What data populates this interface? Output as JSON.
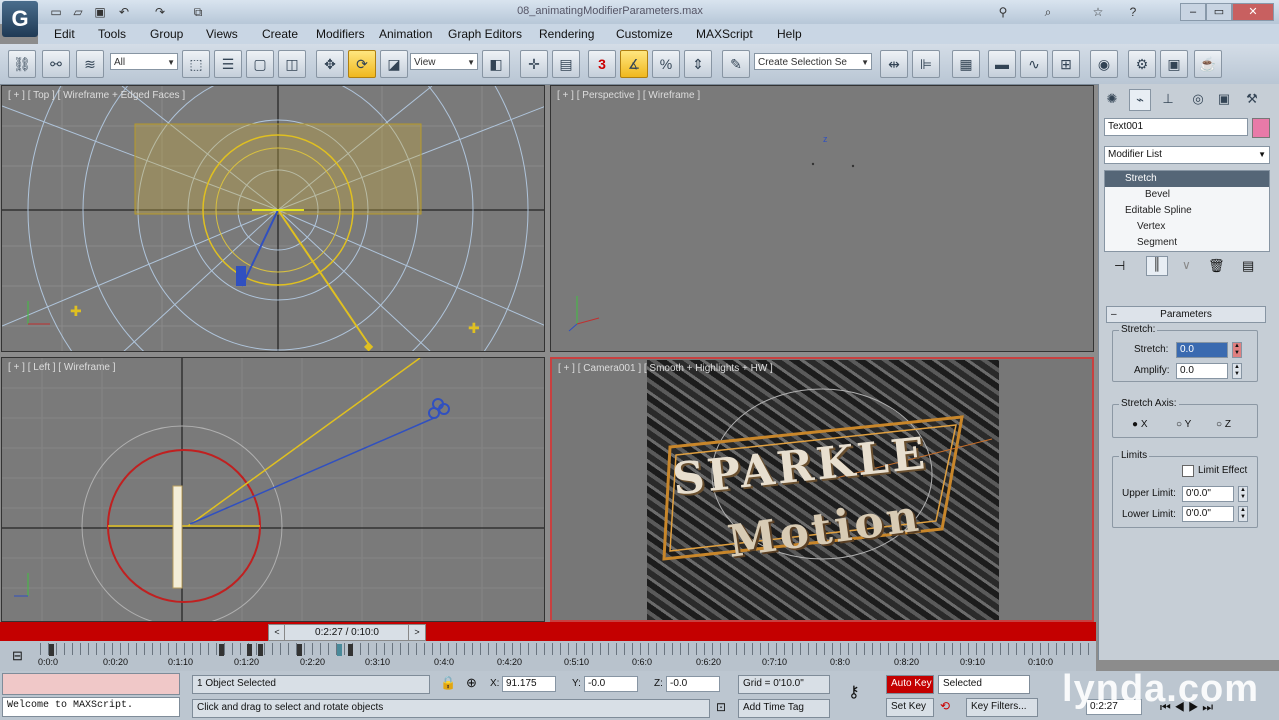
{
  "app": {
    "title": "08_animatingModifierParameters.max",
    "logo": "G"
  },
  "quick_access": [
    "new-icon",
    "open-icon",
    "save-icon",
    "undo-icon",
    "redo-icon",
    "project-icon"
  ],
  "menu": [
    "Edit",
    "Tools",
    "Group",
    "Views",
    "Create",
    "Modifiers",
    "Animation",
    "Graph Editors",
    "Rendering",
    "Customize",
    "MAXScript",
    "Help"
  ],
  "toolbar": {
    "selection_filter": "All",
    "reference_coord": "View",
    "named_selection": "Create Selection Se",
    "snap_label": "3"
  },
  "viewports": {
    "top": "[ + ] [ Top ] [ Wireframe + Edged Faces ]",
    "perspective": "[ + ] [ Perspective ] [ Wireframe ]",
    "left": "[ + ] [ Left ] [ Wireframe ]",
    "camera": "[ + ] [ Camera001 ] [ Smooth + Highlights + HW ]"
  },
  "render": {
    "line1": "SPARKLE",
    "line2": "Motion"
  },
  "command_panel": {
    "object_name": "Text001",
    "modifier_list": "Modifier List",
    "stack": [
      "Stretch",
      "Bevel",
      "Editable Spline",
      "Vertex",
      "Segment"
    ],
    "rollout_title": "Parameters",
    "stretch_group": "Stretch:",
    "stretch_label": "Stretch:",
    "stretch_value": "0.0",
    "amplify_label": "Amplify:",
    "amplify_value": "0.0",
    "axis_group": "Stretch Axis:",
    "axes": [
      "X",
      "Y",
      "Z"
    ],
    "selected_axis": "X",
    "limits_group": "Limits",
    "limit_effect": "Limit Effect",
    "upper_label": "Upper Limit:",
    "upper_value": "0'0.0\"",
    "lower_label": "Lower Limit:",
    "lower_value": "0'0.0\""
  },
  "timeline": {
    "slider_label": "0:2:27 / 0:10:0",
    "ticks": [
      "0:0:0",
      "0:0:20",
      "0:1:10",
      "0:1:20",
      "0:2:20",
      "0:3:10",
      "0:4:0",
      "0:4:20",
      "0:5:10",
      "0:6:0",
      "0:6:20",
      "0:7:10",
      "0:8:0",
      "0:8:20",
      "0:9:10",
      "0:10:0"
    ]
  },
  "status": {
    "maxscript": "Welcome to MAXScript.",
    "selection": "1 Object Selected",
    "prompt": "Click and drag to select and rotate objects",
    "x_label": "X:",
    "x_value": "91.175",
    "y_label": "Y:",
    "y_value": "-0.0",
    "z_label": "Z:",
    "z_value": "-0.0",
    "grid": "Grid = 0'10.0\"",
    "add_time_tag": "Add Time Tag",
    "auto_key": "Auto Key",
    "selected": "Selected",
    "set_key": "Set Key",
    "key_filters": "Key Filters...",
    "current_frame": "0:2:27"
  },
  "watermark": "lynda.com",
  "colors": {
    "auto_key": "#c40000",
    "active_tool": "#f0b81e",
    "camera_border": "#c84040"
  }
}
